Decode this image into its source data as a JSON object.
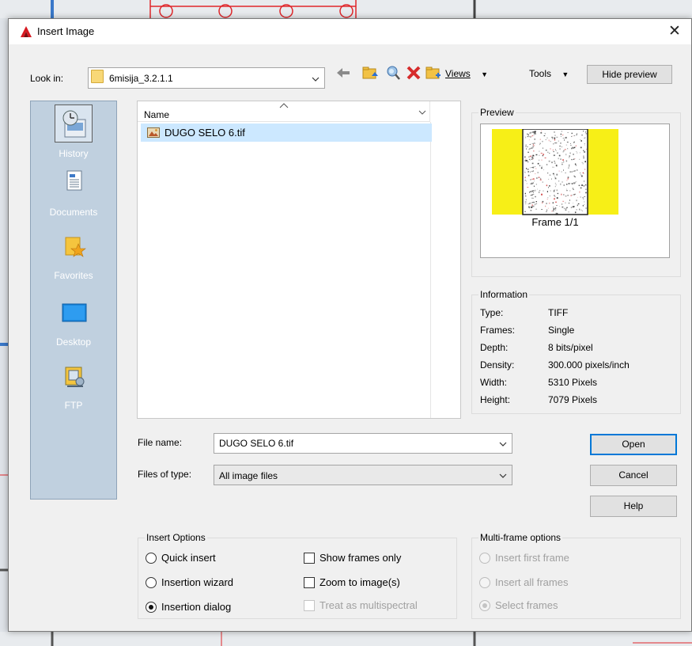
{
  "dialog": {
    "title": "Insert Image",
    "close_glyph": "✕"
  },
  "look_in": {
    "label": "Look in:",
    "value": "6misija_3.2.1.1"
  },
  "toolbar": {
    "views_label": "Views",
    "tools_label": "Tools",
    "hide_preview_label": "Hide preview",
    "icons": [
      "back-arrow-icon",
      "up-folder-icon",
      "search-web-icon",
      "delete-icon",
      "new-folder-icon"
    ]
  },
  "places": [
    {
      "label": "History",
      "icon": "history-icon"
    },
    {
      "label": "Documents",
      "icon": "documents-icon"
    },
    {
      "label": "Favorites",
      "icon": "favorites-icon"
    },
    {
      "label": "Desktop",
      "icon": "desktop-icon"
    },
    {
      "label": "FTP",
      "icon": "ftp-icon"
    }
  ],
  "file_list": {
    "column_name": "Name",
    "files": [
      {
        "name": "DUGO SELO 6.tif",
        "selected": true
      }
    ]
  },
  "preview": {
    "title": "Preview",
    "frame_label": "Frame 1/1"
  },
  "information": {
    "title": "Information",
    "rows": [
      {
        "key": "Type:",
        "value": "TIFF"
      },
      {
        "key": "Frames:",
        "value": "Single"
      },
      {
        "key": "Depth:",
        "value": "8 bits/pixel"
      },
      {
        "key": "Density:",
        "value": "300.000 pixels/inch"
      },
      {
        "key": "Width:",
        "value": "5310 Pixels"
      },
      {
        "key": "Height:",
        "value": "7079 Pixels"
      }
    ]
  },
  "file_name": {
    "label": "File name:",
    "value": "DUGO SELO 6.tif"
  },
  "file_type": {
    "label": "Files of type:",
    "value": "All image files"
  },
  "buttons": {
    "open": "Open",
    "cancel": "Cancel",
    "help": "Help"
  },
  "insert_options": {
    "title": "Insert Options",
    "radios": [
      {
        "label": "Quick insert",
        "checked": false
      },
      {
        "label": "Insertion wizard",
        "checked": false
      },
      {
        "label": "Insertion dialog",
        "checked": true
      }
    ],
    "checks": [
      {
        "label": "Show frames only",
        "checked": false,
        "disabled": false
      },
      {
        "label": "Zoom to image(s)",
        "checked": false,
        "disabled": false
      },
      {
        "label": "Treat as multispectral",
        "checked": false,
        "disabled": true
      }
    ]
  },
  "multiframe": {
    "title": "Multi-frame options",
    "radios": [
      {
        "label": "Insert first frame",
        "checked": false
      },
      {
        "label": "Insert all frames",
        "checked": false
      },
      {
        "label": "Select frames",
        "checked": true
      }
    ]
  },
  "colors": {
    "selection": "#cce8ff",
    "places_bg": "#c0d0df",
    "default_button_border": "#0078d7",
    "cad_red": "#e0262a",
    "preview_yellow": "#f7ef17"
  }
}
